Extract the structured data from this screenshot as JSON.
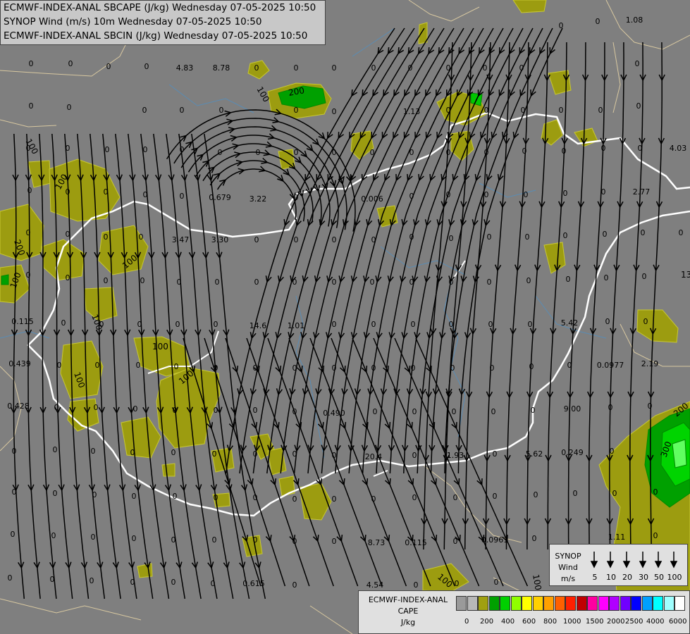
{
  "header": {
    "line1": "ECMWF-INDEX-ANAL SBCAPE (J/kg) Wednesday 07-05-2025 10:50",
    "line2": "SYNOP Wind (m/s) 10m Wednesday 07-05-2025 10:50",
    "line3": "ECMWF-INDEX-ANAL SBCIN (J/kg) Wednesday 07-05-2025 10:50"
  },
  "colors": {
    "background": "#7f7f7f",
    "cape_low": "#9c9c10",
    "cape_200": "#009600",
    "cape_400": "#00c800",
    "border": "#ffffff",
    "province": "#d8c8a0",
    "river": "#5a8cb4",
    "streamline": "#000000"
  },
  "map_values": [
    "0",
    "1.08",
    "4.83",
    "8.78",
    "1.13",
    "0.679",
    "3.22",
    "0.006",
    "2.77",
    "4.03",
    "3.47",
    "3.30",
    "14.6",
    "1.01",
    "5.42",
    "0.0977",
    "2.19",
    "0.115",
    "0.439",
    "0.428",
    "0.490",
    "9.00",
    "20.4",
    "1.93",
    "5.62",
    "0.249",
    "1.11",
    "8.73",
    "0.115",
    "0.0961",
    "4.54",
    "0.615",
    "100",
    "200",
    "300",
    "13"
  ],
  "synop_legend": {
    "title": "SYNOP",
    "subtitle_1": "Wind",
    "subtitle_2": "m/s",
    "speeds": [
      "5",
      "10",
      "20",
      "30",
      "50",
      "100"
    ]
  },
  "cape_legend": {
    "title_1": "ECMWF-INDEX-ANAL",
    "title_2": "CAPE",
    "unit": "J/kg",
    "colors": [
      "#9a9a9a",
      "#b8b8b8",
      "#a0a010",
      "#00a000",
      "#00d000",
      "#90ff00",
      "#ffff00",
      "#ffd000",
      "#ffa000",
      "#ff6000",
      "#ff2000",
      "#c00000",
      "#ff00a0",
      "#ff00ff",
      "#b000ff",
      "#7000ff",
      "#0000ff",
      "#00a0ff",
      "#00ffff",
      "#a0ffff",
      "#ffffff"
    ],
    "ticks": [
      "0",
      "200",
      "400",
      "600",
      "800",
      "1000",
      "1500",
      "2000",
      "2500",
      "4000",
      "6000"
    ]
  }
}
